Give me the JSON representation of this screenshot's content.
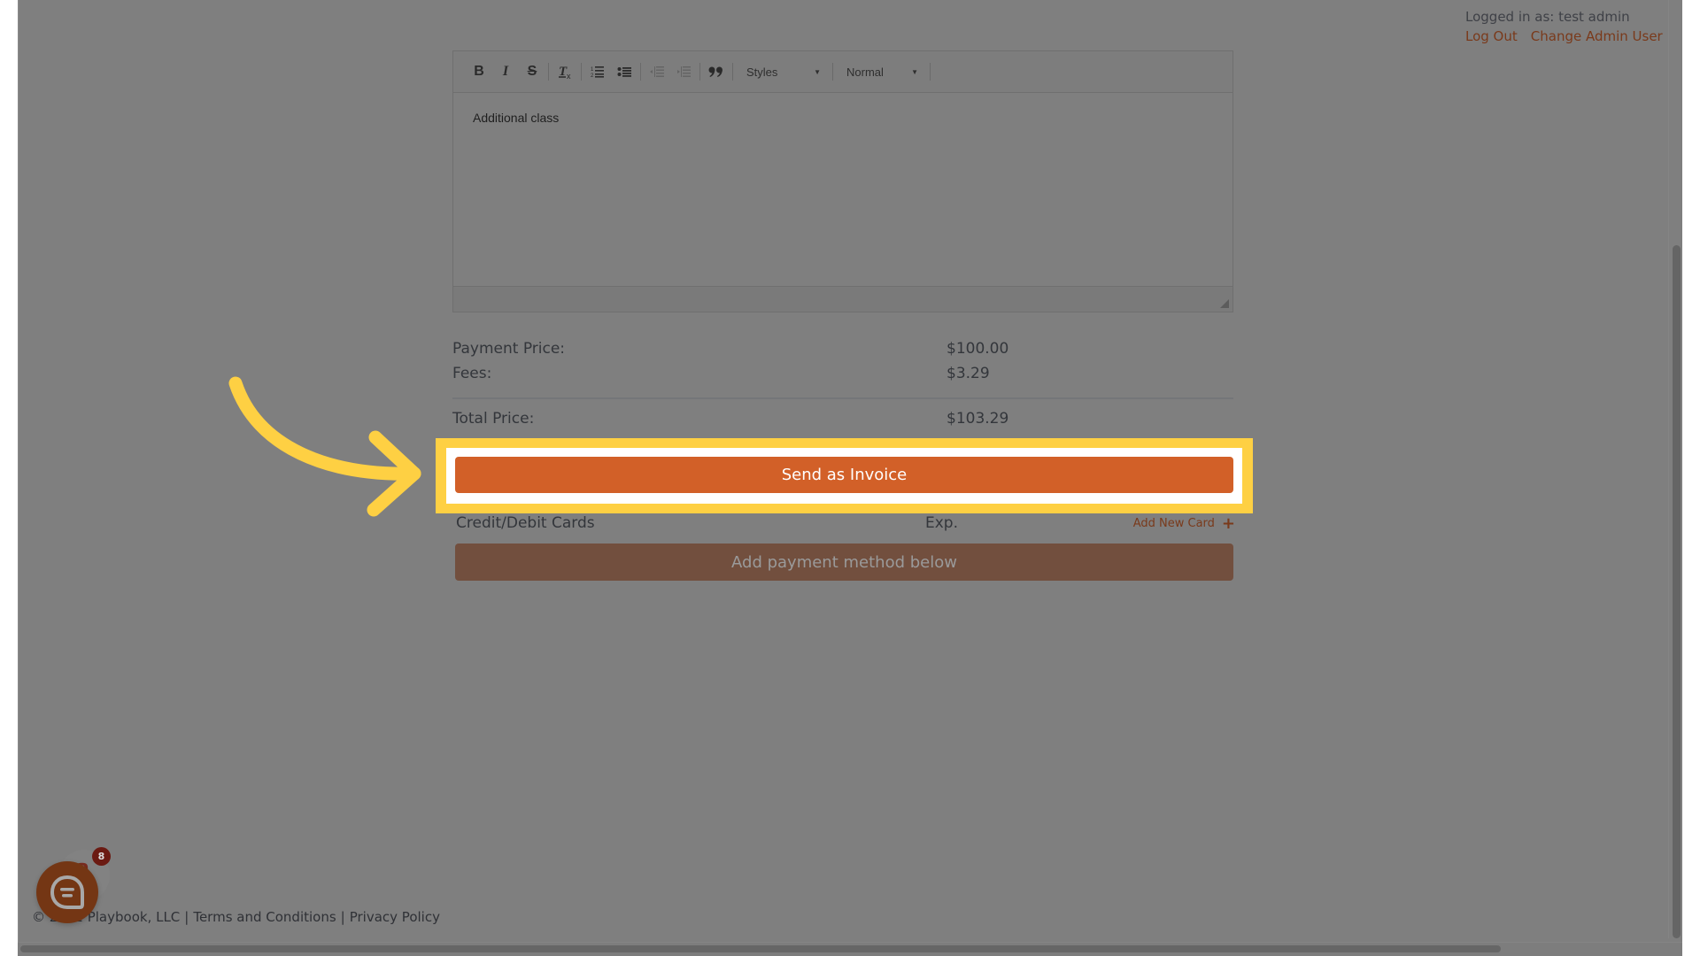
{
  "header": {
    "logged_in_text": "Logged in as: test admin",
    "logout_label": "Log Out",
    "change_admin_label": "Change Admin User"
  },
  "editor": {
    "toolbar": {
      "bold": "B",
      "italic": "I",
      "strike": "S",
      "styles_label": "Styles",
      "format_label": "Normal"
    },
    "content": "Additional class"
  },
  "pricing": {
    "payment_price_label": "Payment Price:",
    "payment_price_value": "$100.00",
    "fees_label": "Fees:",
    "fees_value": "$3.29",
    "total_label": "Total Price:",
    "total_value": "$103.29"
  },
  "actions": {
    "send_invoice_label": "Send as Invoice"
  },
  "cards": {
    "title": "Credit/Debit Cards",
    "exp_label": "Exp.",
    "add_card_label": "Add New Card",
    "add_payment_label": "Add payment method below"
  },
  "footer": {
    "copyright": "© 2022 Playbook, LLC",
    "sep1": "|",
    "terms": "Terms and Conditions",
    "sep2": "|",
    "privacy": "Privacy Policy"
  },
  "chat": {
    "badge_count": "8"
  },
  "annotation": {
    "highlight_color": "#fed043",
    "button_color": "#d26028"
  }
}
